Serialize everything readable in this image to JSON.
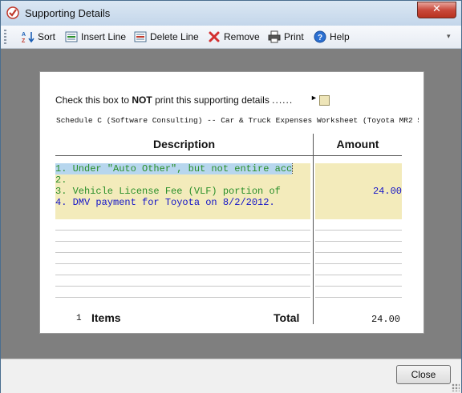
{
  "window": {
    "title": "Supporting Details"
  },
  "toolbar": {
    "sort": "Sort",
    "insert_line": "Insert Line",
    "delete_line": "Delete Line",
    "remove": "Remove",
    "print": "Print",
    "help": "Help"
  },
  "sheet": {
    "check_prefix": "Check this box to ",
    "check_bold": "NOT",
    "check_suffix": " print this supporting details",
    "check_dots": "......",
    "checkbox_checked": false,
    "schedule_title": "Schedule C (Software Consulting) -- Car & Truck Expenses Worksheet (Toyota MR2 S",
    "col_description": "Description",
    "col_amount": "Amount",
    "rows": [
      {
        "description": "1. Under \"Auto Other\", but not entire acc",
        "amount": "",
        "color": "green"
      },
      {
        "description": "2.",
        "amount": "",
        "color": "green"
      },
      {
        "description": "3. Vehicle License Fee (VLF) portion of",
        "amount": "24.00",
        "color": "green"
      },
      {
        "description": "4. DMV payment for Toyota on 8/2/2012.",
        "amount": "",
        "color": "blue"
      },
      {
        "description": "",
        "amount": "",
        "color": "blue"
      }
    ],
    "items_count": "1",
    "items_label": "Items",
    "total_label": "Total",
    "total_amount": "24.00"
  },
  "footer": {
    "close_label": "Close"
  },
  "colors": {
    "text_green": "#2a8f2a",
    "text_blue": "#1414c8",
    "fill": "#f3ebbb"
  }
}
